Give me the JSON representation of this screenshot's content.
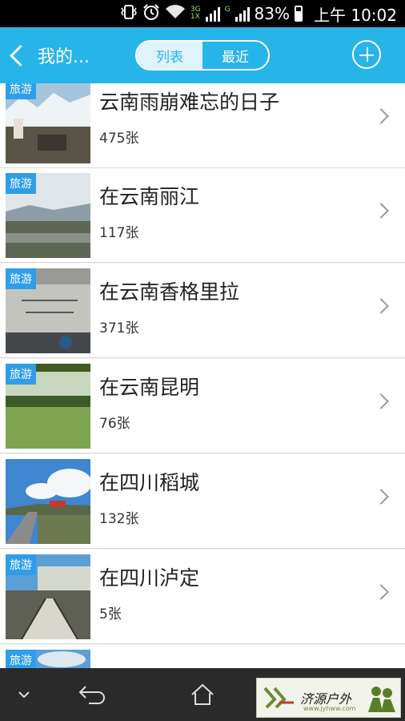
{
  "status_bar": {
    "network_3g": "3G",
    "network_1x": "1X",
    "network_g": "G",
    "battery": "83%",
    "time": "上午 10:02"
  },
  "header": {
    "back_label": "我的...",
    "tabs": [
      {
        "label": "列表",
        "active": true
      },
      {
        "label": "最近",
        "active": false
      }
    ],
    "add_icon": "plus-circle-icon"
  },
  "albums": [
    {
      "tag": "旅游",
      "title": "云南雨崩难忘的日子",
      "count": "475张",
      "thumb_colors": [
        "#a6c4dc",
        "#eef3f6",
        "#5a5448"
      ]
    },
    {
      "tag": "旅游",
      "title": "在云南丽江",
      "count": "117张",
      "thumb_colors": [
        "#dfe5e8",
        "#8e9ca6",
        "#5d6655"
      ]
    },
    {
      "tag": "旅游",
      "title": "在云南香格里拉",
      "count": "371张",
      "thumb_colors": [
        "#9a9a96",
        "#c4c4bf",
        "#45484a"
      ]
    },
    {
      "tag": "旅游",
      "title": "在云南昆明",
      "count": "76张",
      "thumb_colors": [
        "#415a22",
        "#c7d6bd",
        "#7fa552"
      ]
    },
    {
      "tag": "",
      "title": "在四川稻城",
      "count": "132张",
      "thumb_colors": [
        "#3f86d0",
        "#f4f6f8",
        "#596848"
      ]
    },
    {
      "tag": "旅游",
      "title": "在四川泸定",
      "count": "5张",
      "thumb_colors": [
        "#5aa0d6",
        "#d5d8cf",
        "#5e5f55"
      ]
    },
    {
      "tag": "旅游",
      "title": "",
      "count": "",
      "thumb_colors": [
        "#5aa0d6",
        "#dfe7ee",
        "#6a6a62"
      ]
    }
  ],
  "nav": {
    "down_icon": "chevron-down-icon",
    "back_icon": "back-arrow-icon",
    "home_icon": "home-icon",
    "recent_icon": "recent-apps-icon"
  },
  "watermark": {
    "text": "济源户外",
    "url": "www.jyhww.com"
  }
}
